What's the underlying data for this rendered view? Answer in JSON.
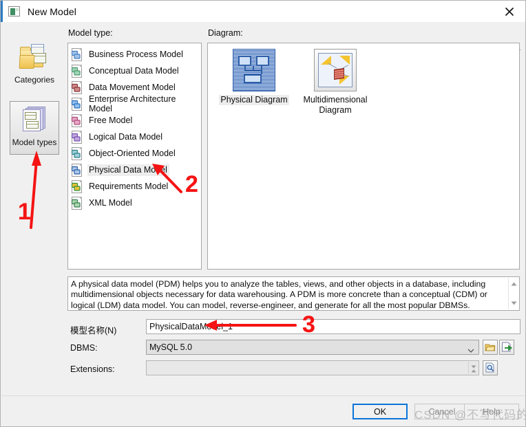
{
  "window": {
    "title": "New Model",
    "icon": "new-model-icon",
    "close_icon": "close-icon"
  },
  "nav": {
    "items": [
      {
        "label": "Categories",
        "icon": "categories-folder-icon",
        "selected": false
      },
      {
        "label": "Model types",
        "icon": "model-types-stack-icon",
        "selected": true
      }
    ]
  },
  "model_type": {
    "label": "Model type:",
    "items": [
      {
        "label": "Business Process Model",
        "icon": "business-process-model-icon",
        "selected": false
      },
      {
        "label": "Conceptual Data Model",
        "icon": "conceptual-data-model-icon",
        "selected": false
      },
      {
        "label": "Data Movement Model",
        "icon": "data-movement-model-icon",
        "selected": false
      },
      {
        "label": "Enterprise Architecture Model",
        "icon": "enterprise-architecture-model-icon",
        "selected": false
      },
      {
        "label": "Free Model",
        "icon": "free-model-icon",
        "selected": false
      },
      {
        "label": "Logical Data Model",
        "icon": "logical-data-model-icon",
        "selected": false
      },
      {
        "label": "Object-Oriented Model",
        "icon": "object-oriented-model-icon",
        "selected": false
      },
      {
        "label": "Physical Data Model",
        "icon": "physical-data-model-icon",
        "selected": true
      },
      {
        "label": "Requirements Model",
        "icon": "requirements-model-icon",
        "selected": false
      },
      {
        "label": "XML Model",
        "icon": "xml-model-icon",
        "selected": false
      }
    ]
  },
  "diagram": {
    "label": "Diagram:",
    "view_toggle_icon": "list-view-icon",
    "view_toggle_caret_icon": "chevron-down-icon",
    "items": [
      {
        "label": "Physical Diagram",
        "icon": "physical-diagram-thumbnail",
        "selected": true
      },
      {
        "label": "Multidimensional Diagram",
        "icon": "multidimensional-diagram-thumbnail",
        "selected": false
      }
    ]
  },
  "description": {
    "text": "A physical data model (PDM) helps you to analyze the tables, views, and other objects in a database, including multidimensional objects necessary for data warehousing. A PDM is more concrete than a conceptual (CDM) or logical (LDM) data model. You can model, reverse-engineer, and generate for all the most popular DBMSs.",
    "scroll_up_icon": "scroll-up-icon",
    "scroll_down_icon": "scroll-down-icon"
  },
  "form": {
    "name": {
      "label": "模型名称(N)",
      "value": "PhysicalDataModel_1",
      "placeholder": ""
    },
    "dbms": {
      "label": "DBMS:",
      "value": "MySQL 5.0",
      "caret_icon": "chevron-down-icon",
      "browse_icon": "folder-open-icon",
      "import_icon": "import-arrow-icon"
    },
    "extensions": {
      "label": "Extensions:",
      "value": "",
      "placeholder": "",
      "spinner_up_icon": "spinner-up-icon",
      "spinner_down_icon": "spinner-down-icon",
      "browse_icon": "magnifier-document-icon"
    }
  },
  "footer": {
    "ok": "OK",
    "cancel": "Cancel",
    "help": "Help"
  },
  "annotations": {
    "markers": [
      {
        "number": "1",
        "target": "model-types-nav-item"
      },
      {
        "number": "2",
        "target": "physical-data-model-list-item"
      },
      {
        "number": "3",
        "target": "dbms-combobox"
      }
    ],
    "accent_color": "#f51313",
    "watermark": "CSDN @不写代码的人个"
  }
}
